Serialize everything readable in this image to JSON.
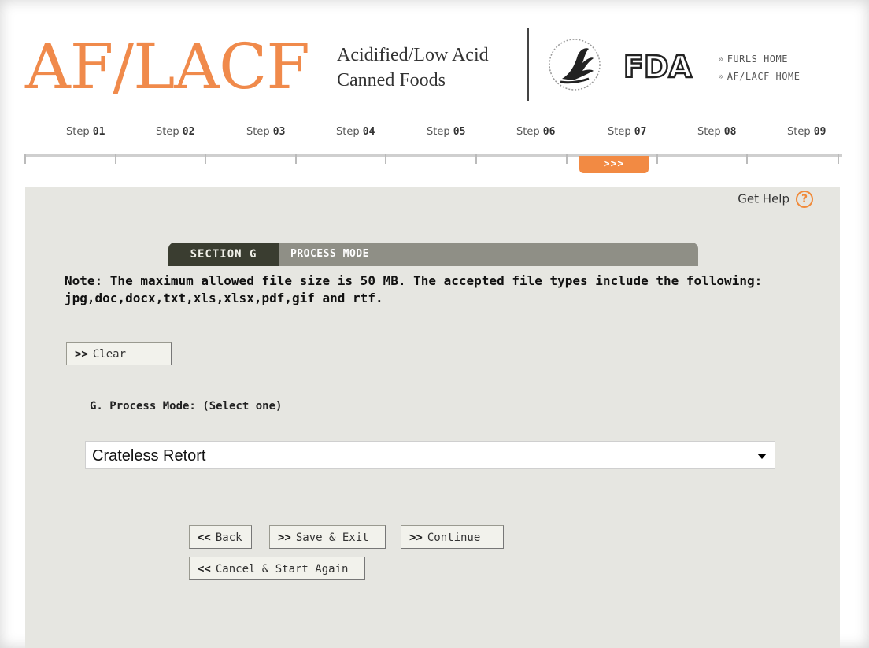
{
  "header": {
    "logo": "AF/LACF",
    "tagline_line1": "Acidified/Low Acid",
    "tagline_line2": "Canned Foods",
    "fda_logo": "FDA",
    "links": [
      {
        "chev": "»",
        "label": "FURLS HOME"
      },
      {
        "chev": "»",
        "label": "AF/LACF HOME"
      }
    ]
  },
  "steps": {
    "prefix": "Step",
    "items": [
      "01",
      "02",
      "03",
      "04",
      "05",
      "06",
      "07",
      "08",
      "09"
    ],
    "active_index": 6,
    "active_marker": ">>>"
  },
  "help": {
    "label": "Get Help",
    "icon": "?"
  },
  "section": {
    "label": "SECTION G",
    "title": "PROCESS MODE"
  },
  "note": {
    "line1": "Note: The maximum allowed file size is 50 MB. The accepted file types include the following:",
    "line2": "jpg,doc,docx,txt,xls,xlsx,pdf,gif and rtf."
  },
  "buttons": {
    "clear": "Clear",
    "back": "Back",
    "save_exit": "Save & Exit",
    "continue": "Continue",
    "cancel_start": "Cancel & Start Again",
    "forward_chev": ">>",
    "back_chev": "<<"
  },
  "form": {
    "process_mode_label": "G. Process Mode: (Select one)",
    "process_mode_value": "Crateless Retort"
  },
  "colors": {
    "accent": "#f08a4b",
    "section_dark": "#3a3d30",
    "section_bar": "#8f8f86",
    "panel": "#e6e6e1"
  }
}
